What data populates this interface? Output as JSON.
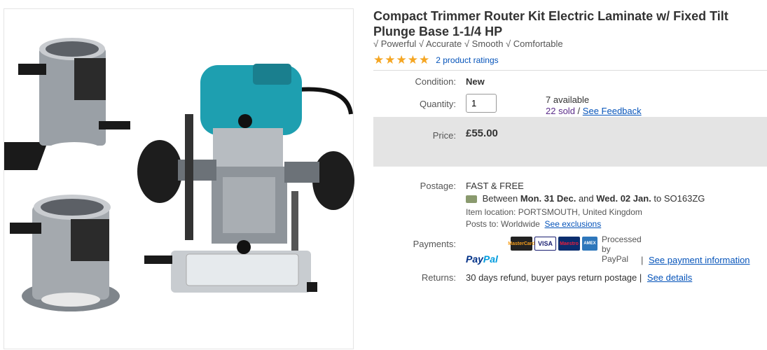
{
  "product": {
    "title": "Compact Trimmer Router Kit Electric Laminate w/ Fixed Tilt Plunge Base 1-1/4 HP",
    "subtitle": "√ Powerful √ Accurate √ Smooth √ Comfortable",
    "ratings_link": "2 product ratings",
    "rating_stars": 5,
    "image_alt": "Trimmer router with fixed and tilt bases"
  },
  "condition": {
    "label": "Condition:",
    "value": "New"
  },
  "quantity": {
    "label": "Quantity:",
    "value": "1",
    "available": "7 available",
    "sold": "22 sold",
    "slash": "/",
    "feedback_link": "See Feedback"
  },
  "price": {
    "label": "Price:",
    "value": "£55.00"
  },
  "postage": {
    "label": "Postage:",
    "value": "FAST & FREE",
    "between": "Between",
    "date_from": "Mon. 31 Dec.",
    "and": "and",
    "date_to": "Wed. 02 Jan.",
    "to": "to SO163ZG",
    "location_label": "Item location:",
    "location": "PORTSMOUTH, United Kingdom",
    "posts_label": "Posts to:",
    "posts_to": "Worldwide",
    "exclusions_link": "See exclusions"
  },
  "payments": {
    "label": "Payments:",
    "paypal_1": "Pay",
    "paypal_2": "Pal",
    "processed_1": "Processed",
    "processed_2": "by",
    "processed_3": "PayPal",
    "pipe": "|",
    "info_link": "See payment information",
    "cards": [
      "MasterCard",
      "VISA",
      "Maestro",
      "AMEX"
    ]
  },
  "returns": {
    "label": "Returns:",
    "value": "30 days refund, buyer pays return postage",
    "pipe": "|",
    "details_link": "See details"
  },
  "colors": {
    "link": "#0654ba",
    "star": "#f5a623",
    "price_bg": "#e4e4e4",
    "tool_teal": "#1e9fb0"
  }
}
